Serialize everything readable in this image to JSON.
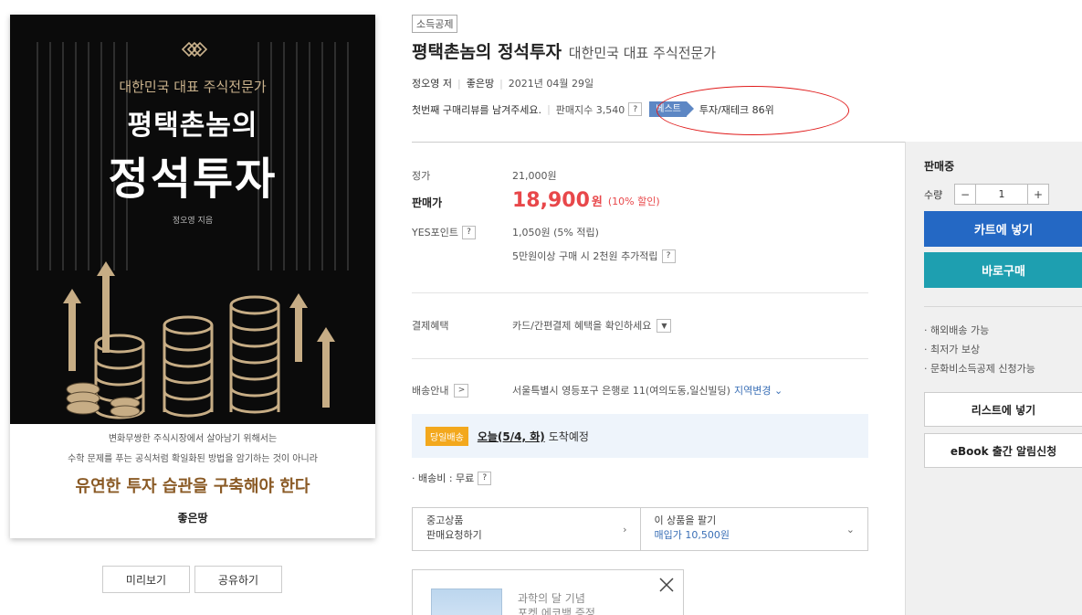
{
  "cover": {
    "subtitle": "대한민국 대표 주식전문가",
    "title_line1": "평택촌놈의",
    "title_line2": "정석투자",
    "author": "정오영 지음",
    "blurb1": "변화무쌍한 주식시장에서 살아남기 위해서는",
    "blurb2": "수학 문제를 푸는 공식처럼 확일화된 방법을 암기하는 것이 아니라",
    "headline": "유연한 투자 습관을 구축해야 한다",
    "publisher": "좋은땅"
  },
  "cover_buttons": {
    "preview": "미리보기",
    "share": "공유하기"
  },
  "book": {
    "badge": "소득공제",
    "title": "평택촌놈의 정석투자",
    "subtitle": "대한민국 대표 주식전문가",
    "author": "정오영 저",
    "publisher": "좋은땅",
    "date": "2021년 04월 29일",
    "review_prompt": "첫번째 구매리뷰를 남겨주세요.",
    "sales_index": "판매지수 3,540",
    "best_label": "베스트",
    "best_rank": "투자/재테크 86위"
  },
  "price": {
    "list_label": "정가",
    "list_value": "21,000원",
    "sale_label": "판매가",
    "sale_value": "18,900",
    "sale_unit": "원",
    "sale_discount": "(10% 할인)",
    "points_label": "YES포인트",
    "points_value": "1,050원 (5% 적립)",
    "points_extra": "5만원이상 구매 시 2천원 추가적립"
  },
  "payment": {
    "label": "결제혜택",
    "value": "카드/간편결제 혜택을 확인하세요"
  },
  "shipping": {
    "label": "배송안내",
    "address": "서울특별시 영등포구 은행로 11(여의도동,일신빌딩)",
    "region_link": "지역변경",
    "sameday_tag": "당일배송",
    "sameday_date": "오늘(5/4, 화)",
    "sameday_arrive": "도착예정",
    "fee": "· 배송비 : 무료"
  },
  "used": {
    "left_line1": "중고상품",
    "left_line2": "판매요청하기",
    "right_line1": "이 상품을 팔기",
    "right_line2": "매입가 10,500원"
  },
  "promo": {
    "line1": "과학의 달 기념",
    "line2": "포켓 에코백 증정"
  },
  "sidebar": {
    "status": "판매중",
    "qty_label": "수량",
    "qty_minus": "−",
    "qty_value": "1",
    "qty_plus": "+",
    "cart": "카트에 넣기",
    "buy": "바로구매",
    "notes": [
      "해외배송 가능",
      "최저가 보상",
      "문화비소득공제 신청가능"
    ],
    "wishlist": "리스트에 넣기",
    "ebook": "eBook 출간 알림신청"
  },
  "icons": {
    "help": "?",
    "dropdown": "chevron-down-icon",
    "arrow": "chevron-right-icon"
  },
  "colors": {
    "sale_red": "#e8474a",
    "cart_blue": "#2468c4",
    "buy_teal": "#1e9fb0",
    "best_blue": "#5d87c4",
    "annotation_red": "#e01b1b"
  }
}
